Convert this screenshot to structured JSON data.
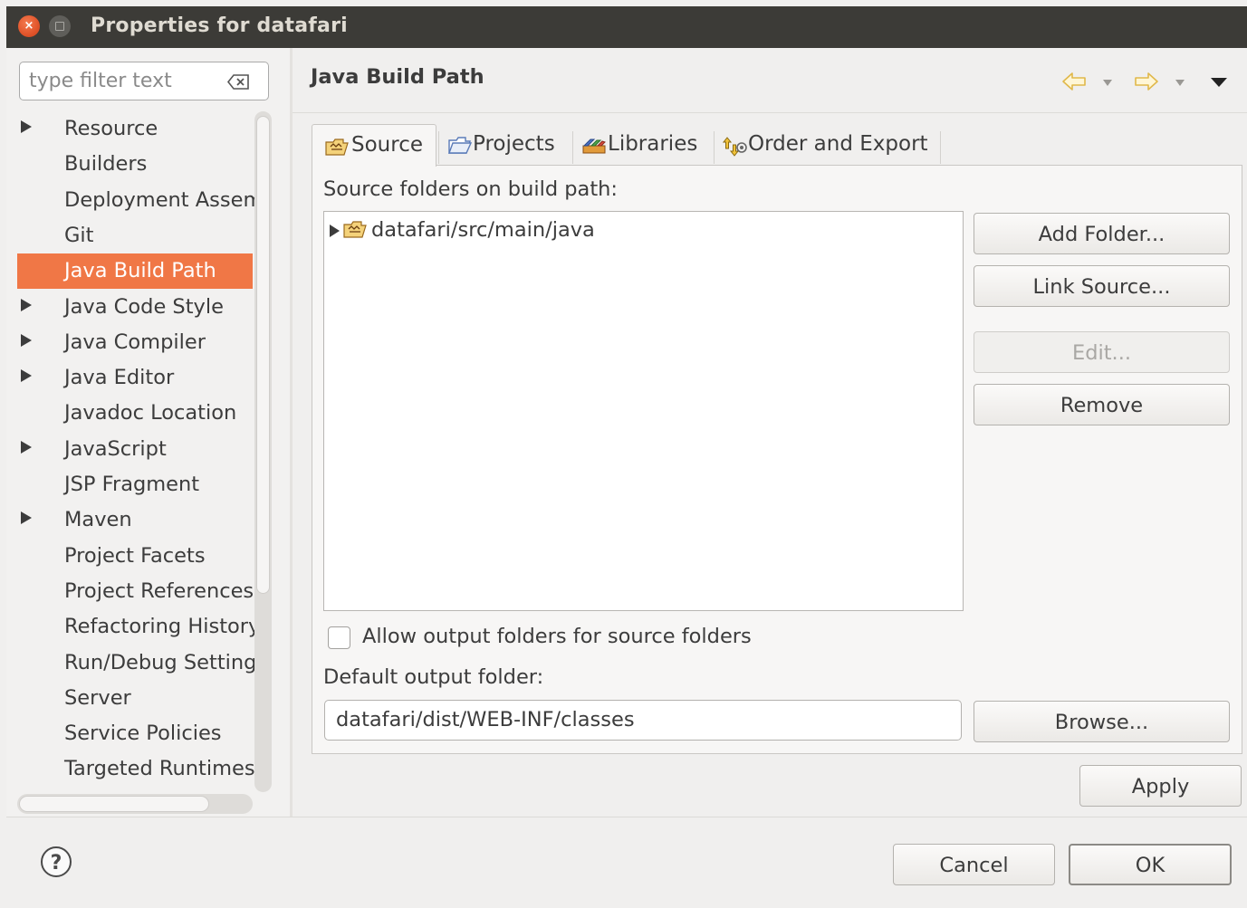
{
  "window": {
    "title": "Properties for datafari",
    "close_glyph": "×"
  },
  "filter": {
    "placeholder": "type filter text"
  },
  "tree": {
    "items": [
      {
        "label": "Resource",
        "expandable": true
      },
      {
        "label": "Builders",
        "expandable": false
      },
      {
        "label": "Deployment Assembly",
        "expandable": false
      },
      {
        "label": "Git",
        "expandable": false
      },
      {
        "label": "Java Build Path",
        "expandable": false,
        "selected": true
      },
      {
        "label": "Java Code Style",
        "expandable": true
      },
      {
        "label": "Java Compiler",
        "expandable": true
      },
      {
        "label": "Java Editor",
        "expandable": true
      },
      {
        "label": "Javadoc Location",
        "expandable": false
      },
      {
        "label": "JavaScript",
        "expandable": true
      },
      {
        "label": "JSP Fragment",
        "expandable": false
      },
      {
        "label": "Maven",
        "expandable": true
      },
      {
        "label": "Project Facets",
        "expandable": false
      },
      {
        "label": "Project References",
        "expandable": false
      },
      {
        "label": "Refactoring History",
        "expandable": false
      },
      {
        "label": "Run/Debug Settings",
        "expandable": false
      },
      {
        "label": "Server",
        "expandable": false
      },
      {
        "label": "Service Policies",
        "expandable": false
      },
      {
        "label": "Targeted Runtimes",
        "expandable": false
      }
    ]
  },
  "page": {
    "title": "Java Build Path"
  },
  "tabs": [
    {
      "label": "Source",
      "icon": "source-folder-icon"
    },
    {
      "label": "Projects",
      "icon": "projects-folder-icon"
    },
    {
      "label": "Libraries",
      "icon": "libraries-icon"
    },
    {
      "label": "Order and Export",
      "icon": "order-export-icon"
    }
  ],
  "source_tab": {
    "list_label": "Source folders on build path:",
    "folders": [
      "datafari/src/main/java"
    ],
    "buttons": {
      "add_folder": "Add Folder...",
      "link_source": "Link Source...",
      "edit": "Edit...",
      "remove": "Remove",
      "browse": "Browse..."
    },
    "allow_output_label": "Allow output folders for source folders",
    "allow_output_checked": false,
    "default_output_label": "Default output folder:",
    "default_output_value": "datafari/dist/WEB-INF/classes"
  },
  "apply_label": "Apply",
  "footer": {
    "cancel_label": "Cancel",
    "ok_label": "OK",
    "help_glyph": "?"
  },
  "colors": {
    "selection": "#f07746",
    "titlebar": "#3c3b37",
    "close_button": "#e1542a"
  }
}
